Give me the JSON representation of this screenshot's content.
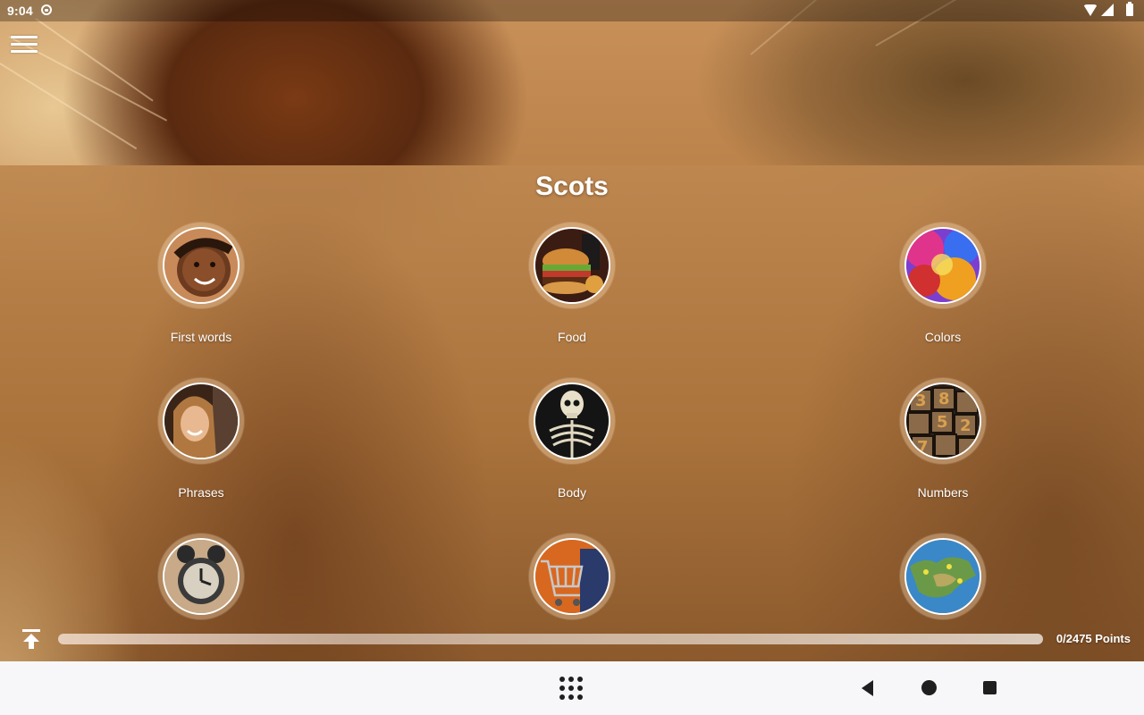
{
  "status_bar": {
    "time": "9:04"
  },
  "header": {
    "title": "Scots"
  },
  "categories": [
    {
      "label": "First words",
      "icon": "child-face-photo"
    },
    {
      "label": "Food",
      "icon": "burger-photo"
    },
    {
      "label": "Colors",
      "icon": "color-powder-photo"
    },
    {
      "label": "Phrases",
      "icon": "woman-smiling-photo"
    },
    {
      "label": "Body",
      "icon": "skeleton-photo"
    },
    {
      "label": "Numbers",
      "icon": "number-blocks-photo"
    },
    {
      "label": "",
      "icon": "alarm-clock-photo"
    },
    {
      "label": "",
      "icon": "shopping-cart-photo"
    },
    {
      "label": "",
      "icon": "world-map-photo"
    }
  ],
  "progress": {
    "points_text": "0/2475 Points",
    "fraction": 0
  },
  "colors": {
    "title_text": "#ffffff",
    "nav_bar_bg": "#f7f7fa",
    "nav_icon": "#1f1f1f"
  }
}
